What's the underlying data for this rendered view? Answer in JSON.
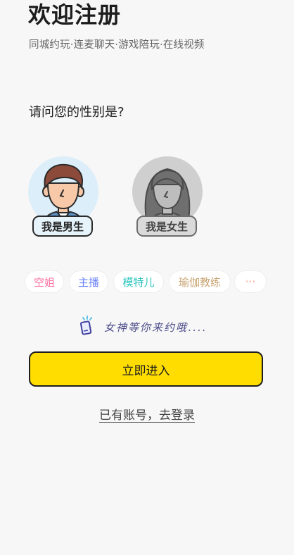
{
  "header": {
    "title": "欢迎注册",
    "subtitle": "同城约玩·连麦聊天·游戏陪玩·在线视频"
  },
  "gender": {
    "question": "请问您的性别是?",
    "male_label": "我是男生",
    "female_label": "我是女生"
  },
  "tags": [
    {
      "label": "空姐",
      "color": "#ff6fa0"
    },
    {
      "label": "主播",
      "color": "#6a82ff"
    },
    {
      "label": "模特儿",
      "color": "#27c4bf"
    },
    {
      "label": "瑜伽教练",
      "color": "#c8a472"
    },
    {
      "label": "···",
      "color": "#ff9a7a"
    }
  ],
  "slogan": {
    "text": "女神等你来约哦....",
    "icon": "phone-icon"
  },
  "actions": {
    "enter_label": "立即进入",
    "login_link": "已有账号，去登录"
  },
  "colors": {
    "accent": "#ffdd00",
    "background": "#f7f7f7"
  }
}
